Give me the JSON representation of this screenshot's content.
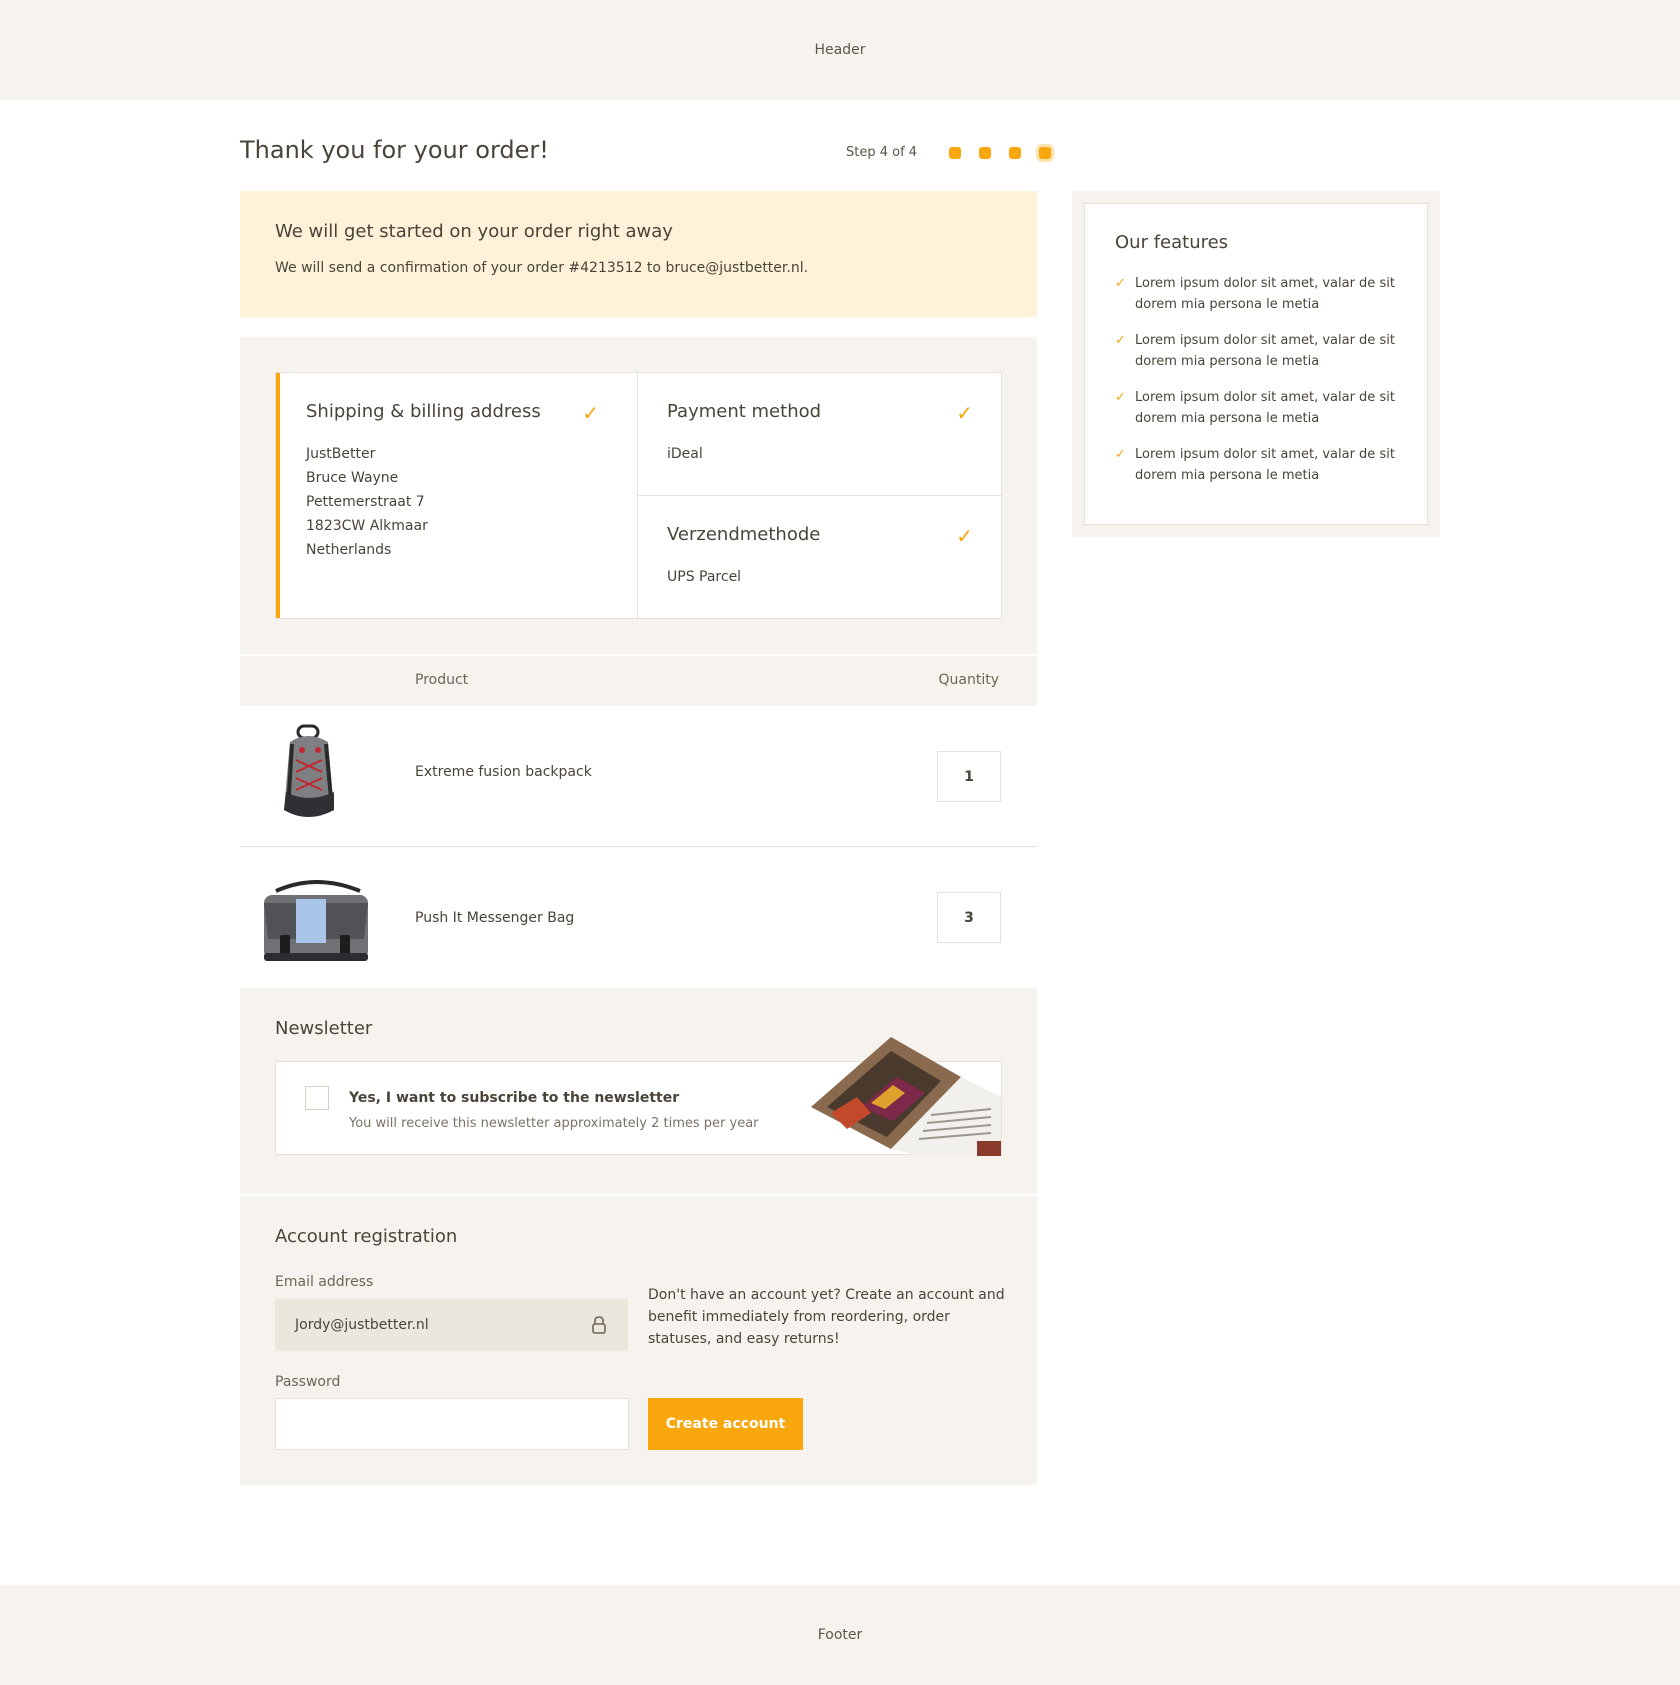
{
  "header": {
    "label": "Header"
  },
  "footer": {
    "label": "Footer"
  },
  "page": {
    "title": "Thank you for your order!",
    "step_text": "Step 4 of 4",
    "step_current": 4,
    "step_total": 4
  },
  "confirmation": {
    "title": "We will get started on your order right away",
    "text": "We will send a confirmation of your order #4213512 to bruce@justbetter.nl."
  },
  "summary": {
    "address": {
      "title": "Shipping & billing address",
      "lines": [
        "JustBetter",
        "Bruce Wayne",
        "Pettemerstraat 7",
        "1823CW Alkmaar",
        "Netherlands"
      ]
    },
    "payment": {
      "title": "Payment method",
      "value": "iDeal"
    },
    "shipping": {
      "title": "Verzendmethode",
      "value": "UPS Parcel"
    }
  },
  "products": {
    "headers": {
      "product": "Product",
      "quantity": "Quantity"
    },
    "items": [
      {
        "name": "Extreme fusion backpack",
        "quantity": "1"
      },
      {
        "name": "Push It Messenger Bag",
        "quantity": "3"
      }
    ]
  },
  "newsletter": {
    "title": "Newsletter",
    "checkbox_label": "Yes, I want to subscribe to the newsletter",
    "checkbox_sub": "You will receive this newsletter approximately 2 times per year"
  },
  "account": {
    "title": "Account registration",
    "email_label": "Email address",
    "email_value": "Jordy@justbetter.nl",
    "password_label": "Password",
    "info": "Don't have an account yet? Create an account and benefit immediately from reordering, order statuses, and easy returns!",
    "button": "Create account"
  },
  "features": {
    "title": "Our features",
    "items": [
      "Lorem ipsum dolor sit amet, valar de sit dorem mia persona le metia",
      "Lorem ipsum dolor sit amet, valar de sit dorem mia persona le metia",
      "Lorem ipsum dolor sit amet, valar de sit dorem mia persona le metia",
      "Lorem ipsum dolor sit amet, valar de sit dorem mia persona le metia"
    ]
  },
  "colors": {
    "accent": "#f9a70c",
    "panel": "#f6f3ee",
    "notice": "#fef2d9",
    "text": "#4a4438"
  },
  "icons": {
    "check": "check-icon",
    "lock": "lock-icon"
  }
}
